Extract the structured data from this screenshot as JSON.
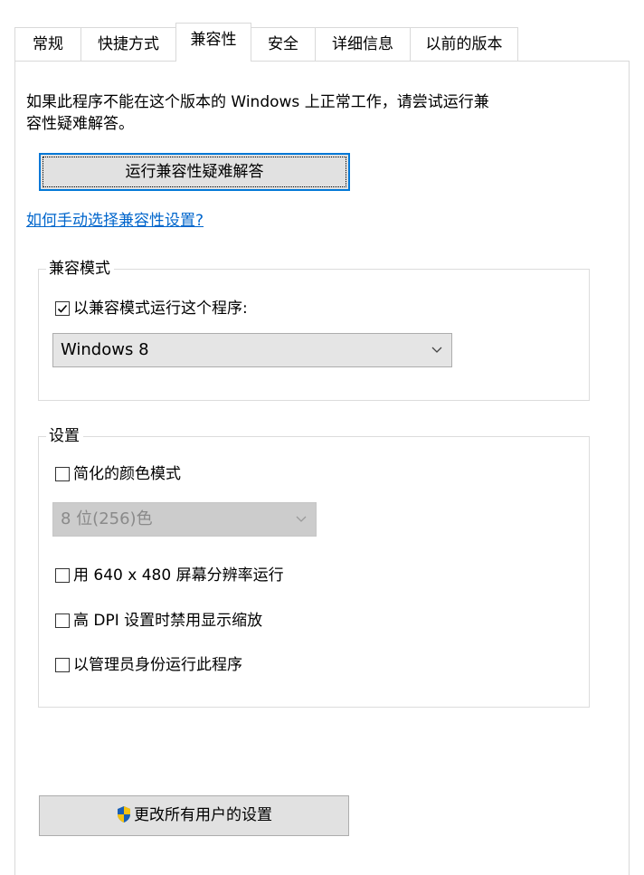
{
  "tabs": [
    {
      "label": "常规"
    },
    {
      "label": "快捷方式"
    },
    {
      "label": "兼容性"
    },
    {
      "label": "安全"
    },
    {
      "label": "详细信息"
    },
    {
      "label": "以前的版本"
    }
  ],
  "intro": {
    "line1": "如果此程序不能在这个版本的 Windows 上正常工作，请尝试运行兼",
    "line2": "容性疑难解答。"
  },
  "troubleshoot_button": "运行兼容性疑难解答",
  "manual_link": "如何手动选择兼容性设置?",
  "compat_mode": {
    "legend": "兼容模式",
    "checkbox_label": "以兼容模式运行这个程序:",
    "checked": true,
    "selected_os": "Windows 8"
  },
  "settings": {
    "legend": "设置",
    "reduced_color": "简化的颜色模式",
    "color_option": "8 位(256)色",
    "res_640": "用 640 x 480 屏幕分辨率运行",
    "high_dpi": "高 DPI 设置时禁用显示缩放",
    "run_admin": "以管理员身份运行此程序"
  },
  "all_users_button": "更改所有用户的设置",
  "colors": {
    "accent": "#0078d7",
    "link": "#0066cc",
    "shield_blue": "#1a5fb4",
    "shield_yellow": "#f5c211"
  },
  "icons": [
    "checkmark-icon",
    "chevron-down-icon",
    "uac-shield-icon"
  ]
}
